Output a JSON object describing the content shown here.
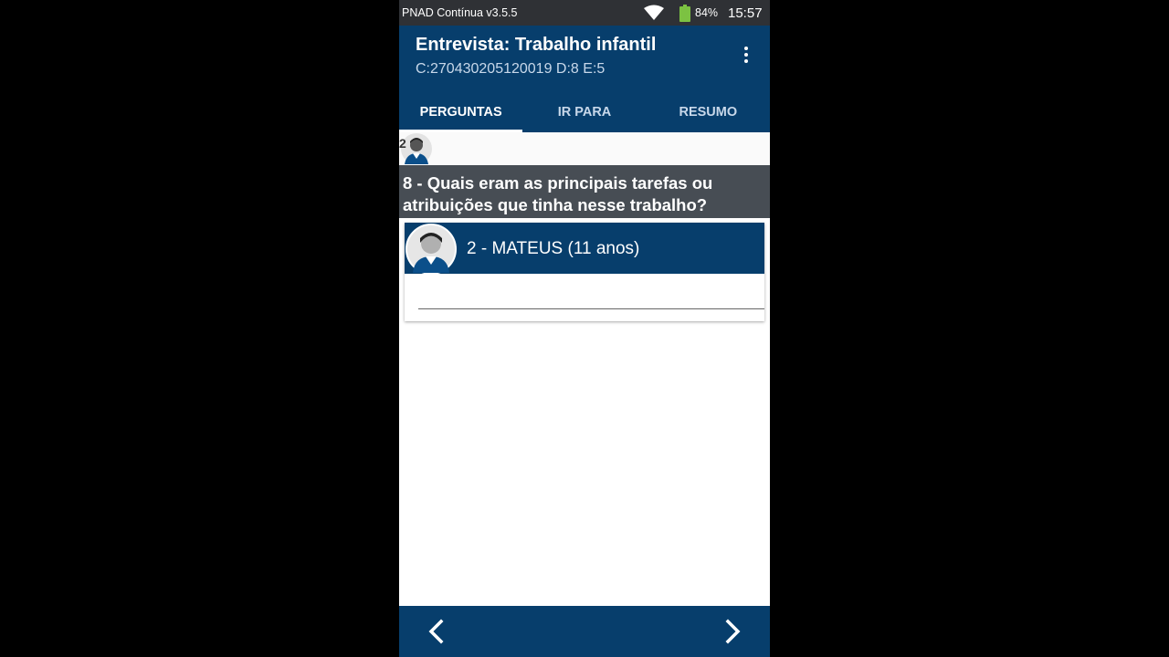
{
  "status_bar": {
    "app_name": "PNAD Contínua v3.5.5",
    "battery": "84%",
    "time": "15:57",
    "icons": [
      "wifi-icon",
      "battery-icon"
    ]
  },
  "header": {
    "title": "Entrevista: Trabalho infantil",
    "subtitle": "C:270430205120019 D:8 E:5",
    "menu_icon": "more-vert-icon"
  },
  "tabs": [
    {
      "label": "PERGUNTAS",
      "active": true
    },
    {
      "label": "IR PARA",
      "active": false
    },
    {
      "label": "RESUMO",
      "active": false
    }
  ],
  "member_strip": {
    "number": "2",
    "icon": "person-avatar-icon"
  },
  "question": {
    "text": "8 - Quais eram as principais tarefas ou atribuições que tinha nesse trabalho?"
  },
  "person": {
    "name": "2 - MATEUS (11 anos)",
    "icon": "person-avatar-icon"
  },
  "answer": {
    "value": ""
  },
  "bottom_nav": {
    "prev_icon": "chevron-left-icon",
    "next_icon": "chevron-right-icon"
  },
  "colors": {
    "primary": "#073e6c",
    "status_bar": "#2f3135",
    "question_bar": "#474d54"
  }
}
